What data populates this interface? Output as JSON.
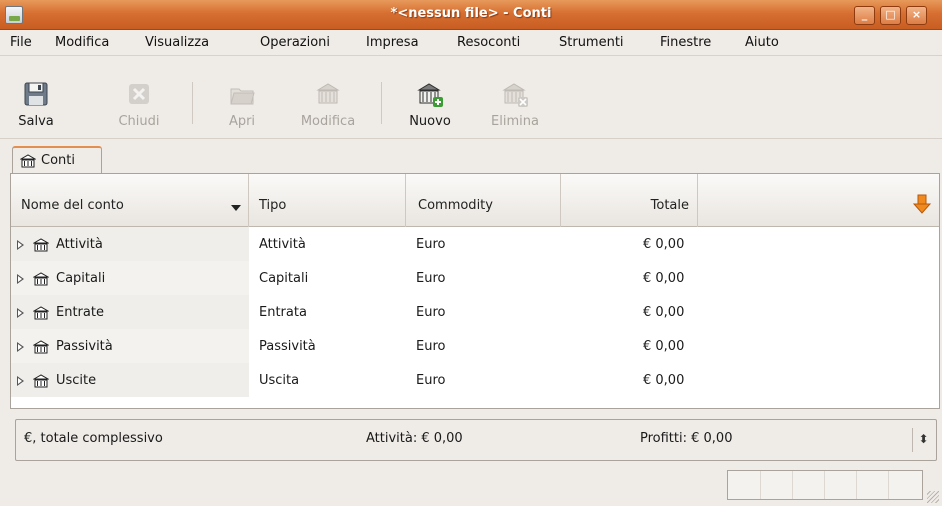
{
  "window": {
    "title": "*<nessun file> - Conti",
    "minimize_glyph": "_",
    "maximize_glyph": "□",
    "close_glyph": "×"
  },
  "menu": [
    {
      "label": "File"
    },
    {
      "label": "Modifica"
    },
    {
      "label": "Visualizza"
    },
    {
      "label": "Operazioni"
    },
    {
      "label": "Impresa"
    },
    {
      "label": "Resoconti"
    },
    {
      "label": "Strumenti"
    },
    {
      "label": "Finestre"
    },
    {
      "label": "Aiuto"
    }
  ],
  "toolbar": {
    "save": "Salva",
    "close": "Chiudi",
    "open": "Apri",
    "edit": "Modifica",
    "new": "Nuovo",
    "delete": "Elimina"
  },
  "tab": {
    "label": "Conti"
  },
  "table": {
    "columns": {
      "name": "Nome del conto",
      "type": "Tipo",
      "commodity": "Commodity",
      "total": "Totale"
    },
    "rows": [
      {
        "name": "Attività",
        "type": "Attività",
        "commodity": "Euro",
        "total": "€ 0,00"
      },
      {
        "name": "Capitali",
        "type": "Capitali",
        "commodity": "Euro",
        "total": "€ 0,00"
      },
      {
        "name": "Entrate",
        "type": "Entrata",
        "commodity": "Euro",
        "total": "€ 0,00"
      },
      {
        "name": "Passività",
        "type": "Passività",
        "commodity": "Euro",
        "total": "€ 0,00"
      },
      {
        "name": "Uscite",
        "type": "Uscita",
        "commodity": "Euro",
        "total": "€ 0,00"
      }
    ]
  },
  "summary": {
    "label": "€, totale complessivo",
    "assets": "Attività: € 0,00",
    "profits": "Profitti: € 0,00",
    "spin_glyph": "⬍"
  },
  "colors": {
    "titlebar_accent": "#d76f32",
    "tab_accent": "#e38f4f",
    "column_picker_arrow": "#f08a1e"
  }
}
